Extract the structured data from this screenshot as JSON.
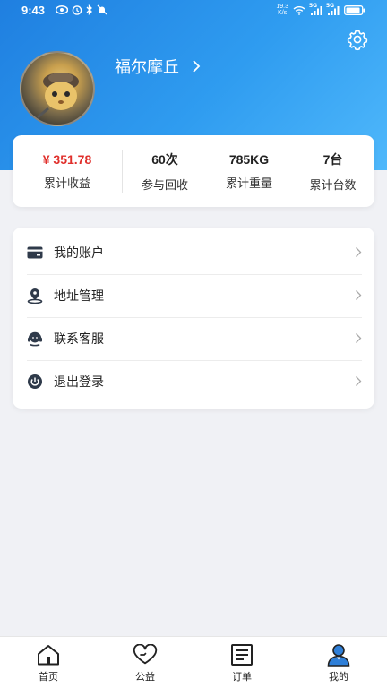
{
  "status_bar": {
    "time": "9:43",
    "net_speed_value": "19.3",
    "net_speed_unit": "K/s",
    "signal_label_1": "5G",
    "signal_label_2": "5G"
  },
  "profile": {
    "username": "福尔摩丘",
    "chevron": "›"
  },
  "stats": [
    {
      "value": "¥ 351.78",
      "label": "累计收益"
    },
    {
      "value": "60次",
      "label": "参与回收"
    },
    {
      "value": "785KG",
      "label": "累计重量"
    },
    {
      "value": "7台",
      "label": "累计台数"
    }
  ],
  "menu": {
    "items": [
      {
        "label": "我的账户",
        "icon": "wallet-icon"
      },
      {
        "label": "地址管理",
        "icon": "location-pin-icon"
      },
      {
        "label": "联系客服",
        "icon": "headset-icon"
      },
      {
        "label": "退出登录",
        "icon": "power-icon"
      }
    ]
  },
  "tabbar": {
    "items": [
      {
        "label": "首页",
        "icon": "home-icon"
      },
      {
        "label": "公益",
        "icon": "heart-icon"
      },
      {
        "label": "订单",
        "icon": "order-list-icon"
      },
      {
        "label": "我的",
        "icon": "user-icon",
        "active": true
      }
    ]
  },
  "colors": {
    "header_gradient_start": "#1f7fe0",
    "header_gradient_end": "#4fb8fb",
    "money_red": "#e0302c",
    "active_tab_accent": "#2f7fd8"
  }
}
